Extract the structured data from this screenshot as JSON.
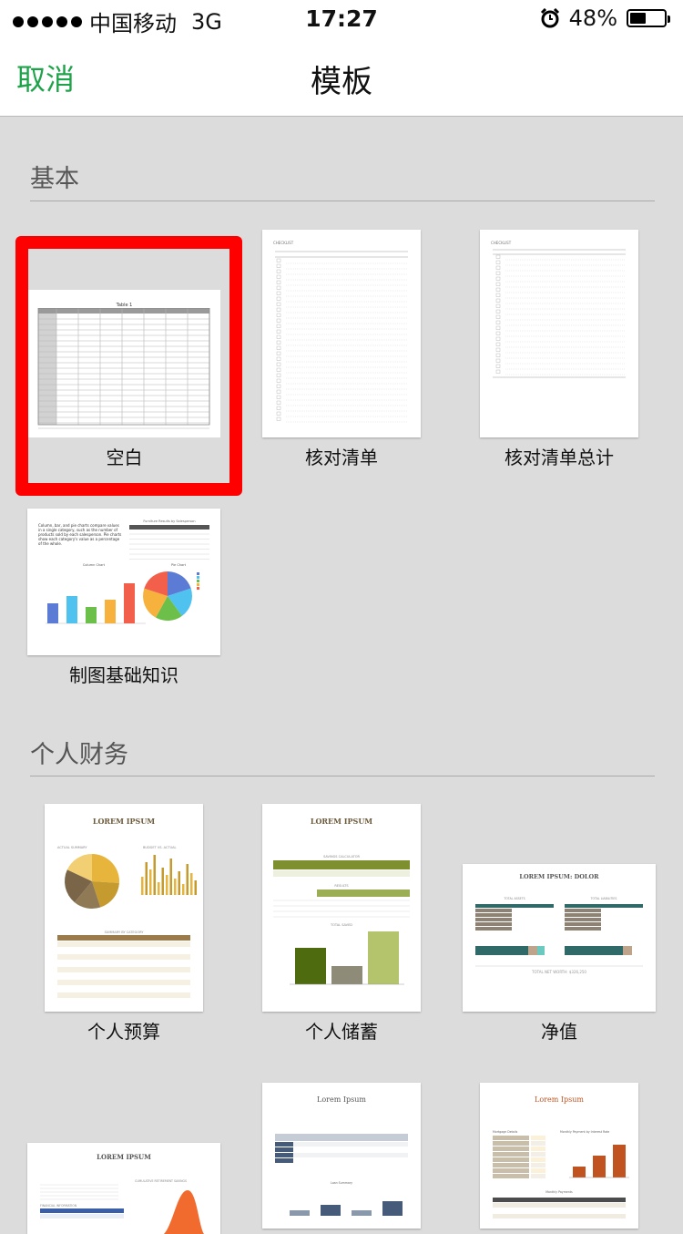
{
  "status": {
    "carrier": "中国移动",
    "network": "3G",
    "time": "17:27",
    "battery_level": 0.48,
    "battery_text": "48%",
    "icons": [
      "signal-dots-icon",
      "alarm-icon",
      "battery-icon"
    ]
  },
  "nav": {
    "cancel": "取消",
    "title": "模板"
  },
  "colors": {
    "accent": "#1fa34a",
    "selection": "#ff0000",
    "background": "#dcdcdc"
  },
  "sections": [
    {
      "title": "基本",
      "templates": [
        {
          "label": "空白",
          "selected": true,
          "thumb": {
            "heading": "Table 1"
          }
        },
        {
          "label": "核对清单",
          "thumb": {
            "heading": "CHECKLIST",
            "cols": [
              "Done",
              "Task"
            ]
          }
        },
        {
          "label": "核对清单总计",
          "thumb": {
            "heading": "CHECKLIST",
            "cols": [
              "Task",
              "Description",
              "Amount"
            ],
            "footer": "Total",
            "amounts": [
              "$150.00",
              "$150.00",
              "$300.00"
            ]
          }
        },
        {
          "label": "制图基础知识",
          "thumb": {
            "intro": "Column, bar, and pie charts compare values in a single category, such as the number of products sold by each salesperson. Pie charts show each category's value as a percentage of the whole.",
            "table_title": "Furniture Results by Salesperson",
            "col_chart_title": "Column Chart",
            "pie_chart_title": "Pie Chart",
            "names": [
              "Anna",
              "Chris",
              "Maria",
              "Jason",
              "Stephen"
            ]
          }
        }
      ]
    },
    {
      "title": "个人财务",
      "templates": [
        {
          "label": "个人预算",
          "thumb": {
            "heading": "LOREM IPSUM",
            "sub1": "ACTUAL SUMMARY",
            "sub2": "BUDGET VS. ACTUAL",
            "sub3": "SUMMARY BY CATEGORY",
            "cols": [
              "Category",
              "Budget",
              "Actual",
              "Difference"
            ]
          }
        },
        {
          "label": "个人储蓄",
          "thumb": {
            "heading": "LOREM IPSUM",
            "sub1": "SAVINGS CALCULATOR",
            "sub2": "RESULTS",
            "sub3": "TOTAL SAVED",
            "bar_values": [
              "$10,000",
              "$5,000",
              "$15,000"
            ]
          }
        },
        {
          "label": "净值",
          "thumb": {
            "heading": "LOREM IPSUM: DOLOR",
            "sub1": "TOTAL ASSETS",
            "sub2": "TOTAL LIABILITIES",
            "footer": "TOTAL NET WORTH: $326,250"
          }
        },
        {
          "label": "",
          "thumb": {
            "heading": "LOREM IPSUM",
            "sub1": "CUMULATIVE RETIREMENT SAVINGS",
            "sub2": "FINANCIAL INFORMATION"
          }
        },
        {
          "label": "",
          "thumb": {
            "heading": "Lorem Ipsum",
            "sub1": "Loan Summary"
          }
        },
        {
          "label": "",
          "thumb": {
            "heading": "Lorem Ipsum",
            "sub1": "Mortgage Details",
            "sub2": "Monthly Payment by Interest Rate",
            "sub3": "Monthly Payments"
          }
        }
      ]
    }
  ]
}
